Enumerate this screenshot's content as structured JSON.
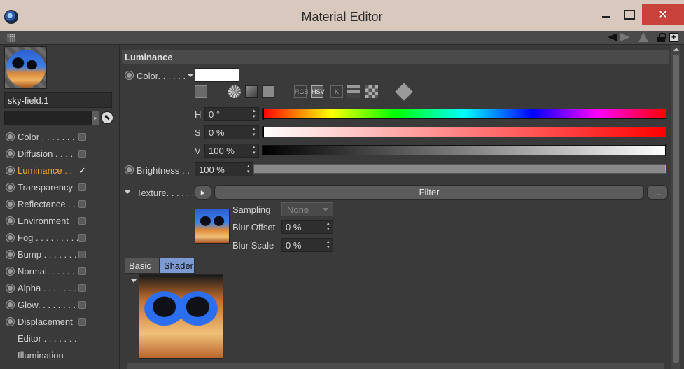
{
  "window": {
    "title": "Material Editor",
    "close_glyph": "✕"
  },
  "toolstrip": {
    "icons": [
      "grip-icon",
      "nav-back-icon",
      "nav-forward-icon",
      "nav-up-icon",
      "lock-icon",
      "new-window-icon"
    ],
    "new_window_glyph": "+"
  },
  "sidebar": {
    "material_name": "sky-field.1",
    "search_value": "",
    "search_arrow_glyph": "▸",
    "picker_glyph": "⬉",
    "channels": [
      {
        "label": "Color . . . . . . . .",
        "checked": false,
        "active": false
      },
      {
        "label": "Diffusion . . . .",
        "checked": false,
        "active": false
      },
      {
        "label": "Luminance . .",
        "checked": true,
        "active": true
      },
      {
        "label": "Transparency",
        "checked": false,
        "active": false
      },
      {
        "label": "Reflectance . .",
        "checked": false,
        "active": false
      },
      {
        "label": "Environment",
        "checked": false,
        "active": false
      },
      {
        "label": "Fog . . . . . . . . .",
        "checked": false,
        "active": false
      },
      {
        "label": "Bump . . . . . . .",
        "checked": false,
        "active": false
      },
      {
        "label": "Normal. . . . . .",
        "checked": false,
        "active": false
      },
      {
        "label": "Alpha . . . . . . .",
        "checked": false,
        "active": false
      },
      {
        "label": "Glow. . . . . . . .",
        "checked": false,
        "active": false
      },
      {
        "label": "Displacement",
        "checked": false,
        "active": false
      }
    ],
    "extra_items": [
      "Editor . . . . . . .",
      "Illumination"
    ],
    "check_glyph": "✓"
  },
  "luminance": {
    "header": "Luminance",
    "color_label": "Color. . . . . .",
    "color_value": "#ffffff",
    "mode_labels": {
      "rgb": "RGB",
      "hsv": "HSV",
      "k": "K"
    },
    "h_label": "H",
    "h_value": "0 °",
    "s_label": "S",
    "s_value": "0 %",
    "v_label": "V",
    "v_value": "100 %",
    "brightness_label": "Brightness . .",
    "brightness_value": "100 %",
    "texture_label": "Texture. . . . . .",
    "texture_arrow": "▸",
    "filter_label": "Filter",
    "more_label": "...",
    "sampling_label": "Sampling",
    "sampling_value": "None",
    "blur_offset_label": "Blur Offset",
    "blur_offset_value": "0 %",
    "blur_scale_label": "Blur Scale",
    "blur_scale_value": "0 %",
    "tabs": [
      "Basic",
      "Shader"
    ],
    "selected_tab": "Shader"
  },
  "colors": {
    "title_bar": "#d9c8be",
    "close_button": "#c8413a",
    "active_channel": "#f0a53a",
    "selected_tab": "#7d9ad2",
    "panel": "#3a3a3a"
  }
}
